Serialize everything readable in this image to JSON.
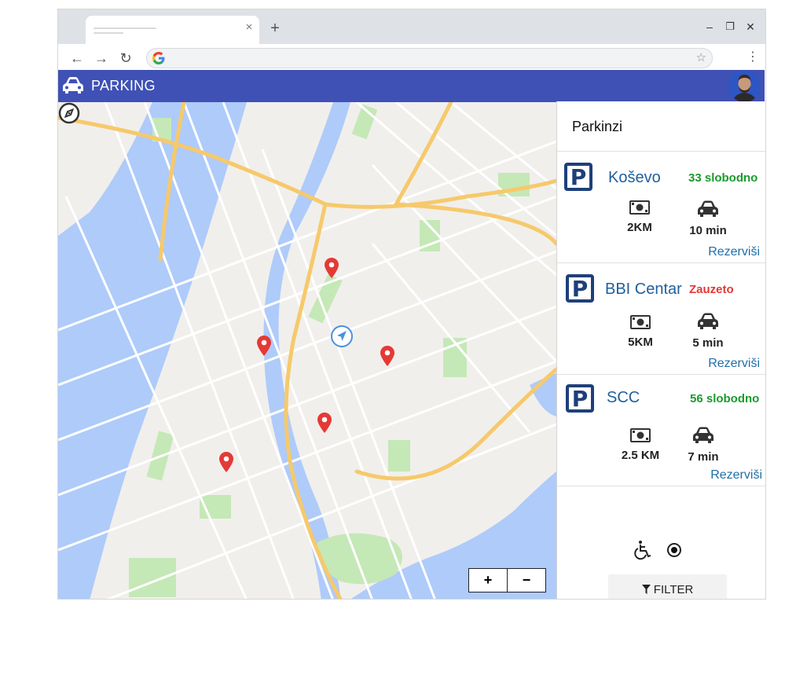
{
  "browser": {
    "tab_close": "×",
    "new_tab": "+",
    "minimize": "–",
    "restore": "❐",
    "close": "✕",
    "back": "←",
    "forward": "→",
    "reload": "↻",
    "url": "",
    "star": "☆",
    "menu": "⋮"
  },
  "app": {
    "title": "PARKING",
    "brand_color": "#3f51b5"
  },
  "map": {
    "zoom_in": "+",
    "zoom_out": "−"
  },
  "panel": {
    "title": "Parkinzi",
    "parkings": [
      {
        "name": "Koševo",
        "status": "33 slobodno",
        "status_color": "#1a9b2c",
        "distance": "2KM",
        "drive_time": "10 min",
        "action": "Rezerviši"
      },
      {
        "name": "BBI Centar",
        "status": "Zauzeto",
        "status_color": "#e53935",
        "distance": "5KM",
        "drive_time": "5 min",
        "action": "Rezerviši"
      },
      {
        "name": "SCC",
        "status": "56 slobodno",
        "status_color": "#1a9b2c",
        "distance": "2.5 KM",
        "drive_time": "7 min",
        "action": "Rezerviši"
      }
    ],
    "filter_label": "FILTER",
    "accessible_selected": true
  },
  "icons": {
    "app_logo": "car-icon",
    "parking": "parking-sign-icon",
    "money": "money-icon",
    "drive": "car-icon",
    "wheelchair": "wheelchair-icon",
    "filter": "filter-icon",
    "pin": "map-pin-icon",
    "locate": "navigation-arrow-icon",
    "compass": "compass-icon"
  }
}
